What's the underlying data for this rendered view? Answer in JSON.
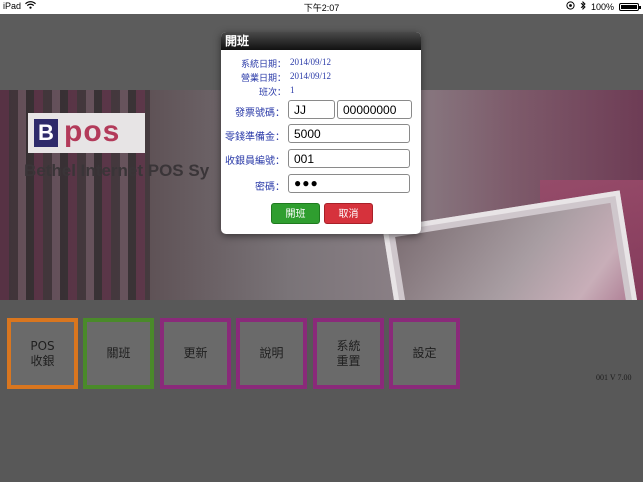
{
  "status_bar": {
    "device": "iPad",
    "wifi_icon": "wifi-icon",
    "time": "下午2:07",
    "battery_percent": "100%",
    "battery_level": 1.0
  },
  "app": {
    "logo_letter": "B",
    "logo_text": "pos",
    "tagline": "Bethel Internet POS Sy"
  },
  "menu": {
    "tiles": [
      {
        "label": "POS\n收銀",
        "color": "#d9761f"
      },
      {
        "label": "關班",
        "color": "#4a8a2a"
      },
      {
        "label": "更新",
        "color": "#8a2a7a"
      },
      {
        "label": "說明",
        "color": "#8a2a7a"
      },
      {
        "label": "系統\n重置",
        "color": "#8a2a7a"
      },
      {
        "label": "設定",
        "color": "#8a2a7a"
      }
    ],
    "version": "001   V 7.00"
  },
  "dialog": {
    "title": "開班",
    "system_date_label": "系統日期：",
    "system_date": "2014/09/12",
    "business_date_label": "營業日期：",
    "business_date": "2014/09/12",
    "shift_label": "班次：",
    "shift": "1",
    "invoice_label": "發票號碼：",
    "invoice_prefix": "JJ",
    "invoice_number": "00000000",
    "petty_cash_label": "零錢準備金：",
    "petty_cash": "5000",
    "cashier_id_label": "收銀員編號：",
    "cashier_id": "001",
    "password_label": "密碼：",
    "password": "●●●",
    "open_button": "開班",
    "cancel_button": "取消",
    "open_color": "#2f9e2f",
    "cancel_color": "#d6323c"
  }
}
